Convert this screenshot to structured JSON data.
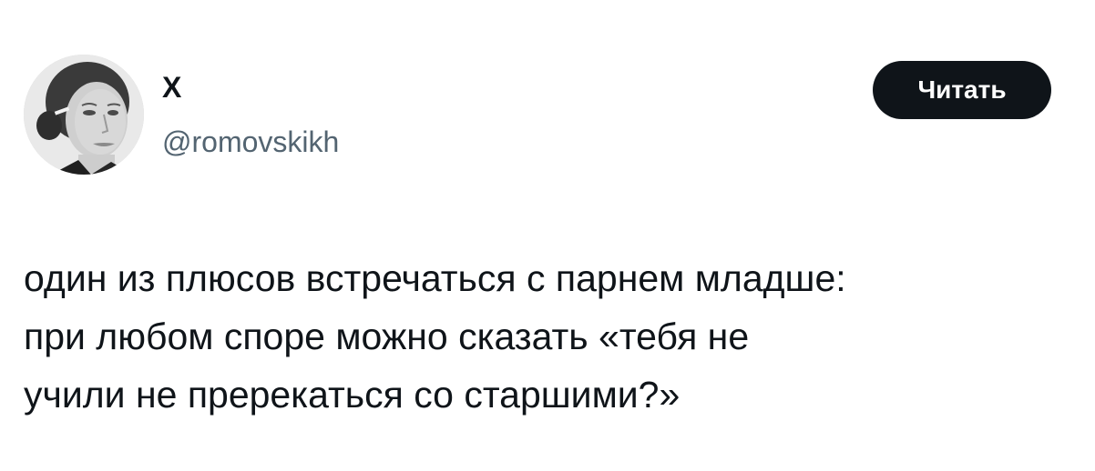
{
  "author": {
    "name": "Х",
    "handle": "@romovskikh"
  },
  "follow_button": {
    "label": "Читать"
  },
  "tweet": {
    "lines": [
      "один из плюсов встречаться с парнем младше:",
      "при любом споре можно сказать «тебя не",
      "учили не пререкаться со старшими?»"
    ]
  },
  "colors": {
    "text": "#0f1419",
    "handle": "#536471",
    "button_bg": "#0f1419",
    "button_text": "#ffffff",
    "background": "#ffffff"
  }
}
